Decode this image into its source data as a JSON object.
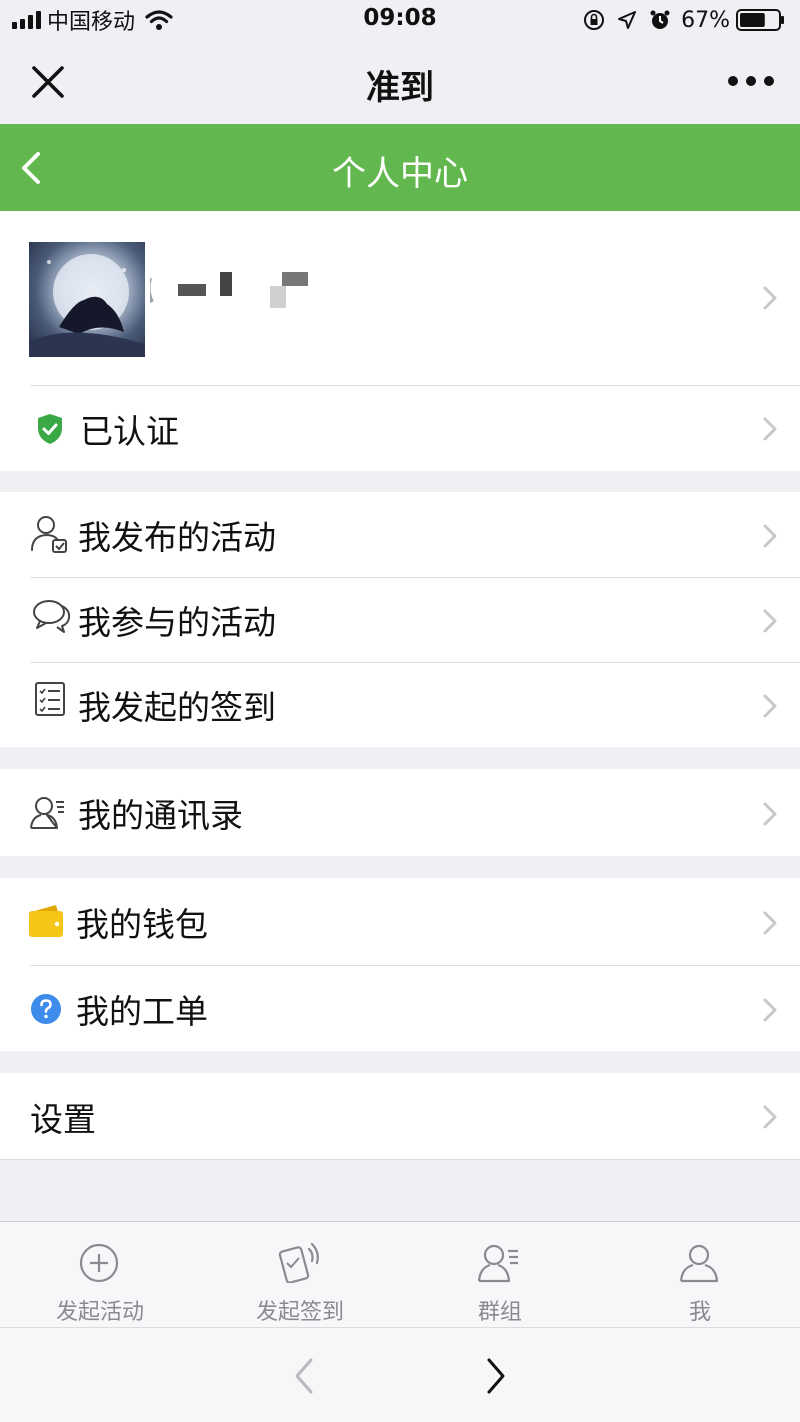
{
  "status_bar": {
    "carrier": "中国移动",
    "time": "09:08",
    "battery": "67%",
    "battery_level": 0.67
  },
  "nav": {
    "title": "准到"
  },
  "page": {
    "title": "个人中心"
  },
  "profile": {
    "verified_label": "已认证"
  },
  "menu": {
    "published_activities": "我发布的活动",
    "joined_activities": "我参与的活动",
    "initiated_checkins": "我发起的签到",
    "contacts": "我的通讯录",
    "wallet": "我的钱包",
    "tickets": "我的工单",
    "settings": "设置"
  },
  "tabbar": {
    "items": [
      {
        "label": "发起活动",
        "icon": "plus-circle-icon"
      },
      {
        "label": "发起签到",
        "icon": "phone-checkin-icon"
      },
      {
        "label": "群组",
        "icon": "contacts-icon"
      },
      {
        "label": "我",
        "icon": "person-icon"
      }
    ]
  },
  "colors": {
    "header_green": "#63b74f",
    "verified_green": "#3aa845",
    "wallet_yellow": "#f5c518",
    "help_blue": "#3d8bea",
    "tab_gray": "#8a8a8f"
  }
}
